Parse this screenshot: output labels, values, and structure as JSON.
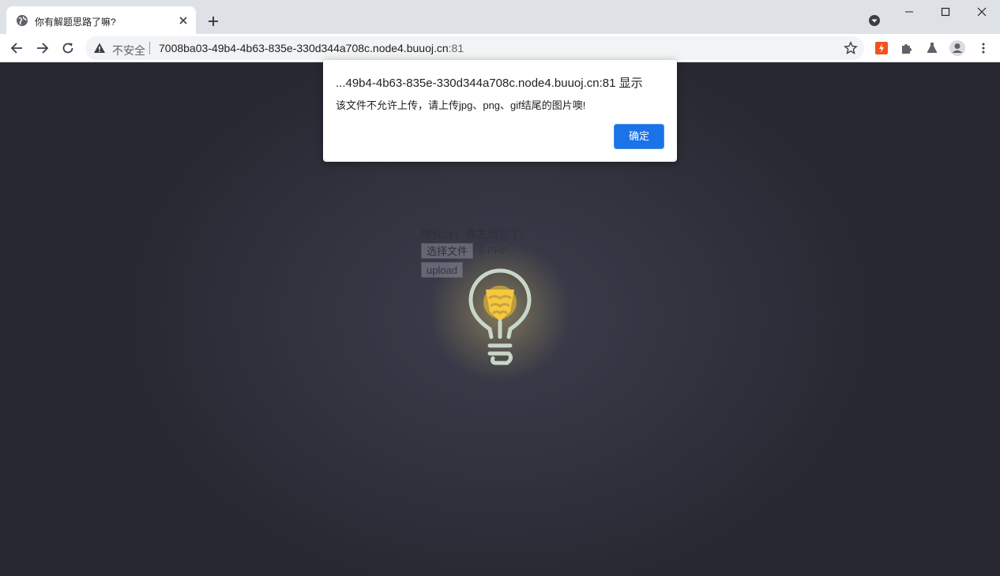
{
  "tab": {
    "title": "你有解题思路了嘛?",
    "favicon_icon": "globe-icon",
    "close_icon": "close-icon"
  },
  "window_controls": {
    "minimize_icon": "minimize-icon",
    "maximize_icon": "maximize-icon",
    "close_icon": "close-icon"
  },
  "toolbar": {
    "security_label": "不安全",
    "url_host": "7008ba03-49b4-4b63-835e-330d344a708c.node4.buuoj.cn",
    "url_port": ":81",
    "icons": [
      "back-icon",
      "forward-icon",
      "reload-icon",
      "star-icon",
      "extension-icon",
      "puzzle-icon",
      "flask-icon",
      "profile-icon",
      "menu-icon"
    ]
  },
  "dialog": {
    "title": "...49b4-4b63-835e-330d344a708c.node4.buuoj.cn:81 显示",
    "message": "该文件不允许上传，请上传jpg、png、gif结尾的图片噢!",
    "ok_label": "确定"
  },
  "page": {
    "hint": "嘿伙计，你发现它了!",
    "file_button": "选择文件",
    "file_name": "6 PHP",
    "upload_button": "upload"
  },
  "colors": {
    "accent": "#1a73e8",
    "page_bg": "#2b2c36",
    "bulb_yellow": "#f5c842",
    "bulb_outline": "#c8d6c8"
  }
}
